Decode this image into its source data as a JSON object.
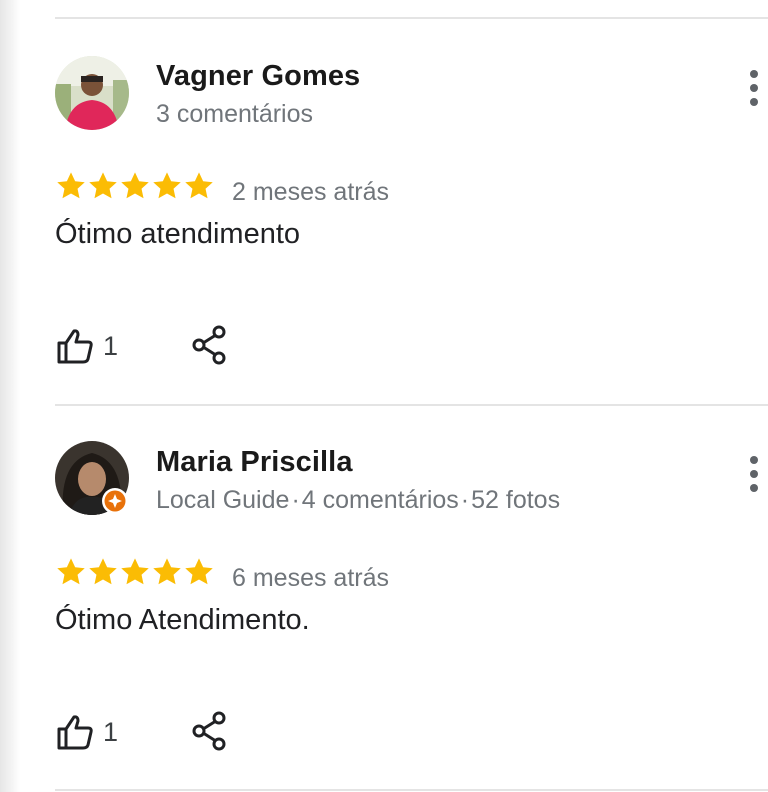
{
  "colors": {
    "star": "#fbbc04",
    "secondary_text": "#70757a",
    "guide_badge": "#e8710a"
  },
  "icons": [
    "more-vert-icon",
    "star-icon",
    "thumbs-up-icon",
    "share-icon",
    "local-guide-badge-icon"
  ],
  "reviews": [
    {
      "name": "Vagner Gomes",
      "meta": "3 comentários",
      "rating": 5,
      "time": "2 meses atrás",
      "text": "Ótimo atendimento",
      "likes": "1"
    },
    {
      "name": "Maria Priscilla",
      "meta_parts": [
        "Local Guide",
        "4 comentários",
        "52 fotos"
      ],
      "separator": "·",
      "rating": 5,
      "time": "6 meses atrás",
      "text": "Ótimo Atendimento.",
      "likes": "1"
    }
  ]
}
